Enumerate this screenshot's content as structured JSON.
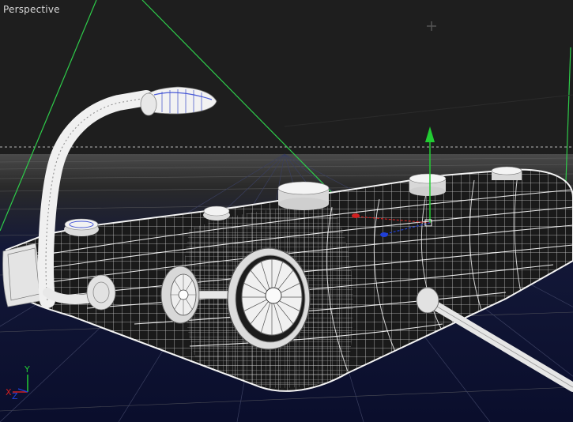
{
  "viewport": {
    "label": "Perspective",
    "mode": "wireframe-shaded"
  },
  "scene": {
    "object": "reel-handle-model",
    "icons": [
      "view-cube-marker-icon",
      "move-gizmo-icon",
      "axis-gizmo-icon"
    ]
  },
  "axis_gizmo": {
    "y_label": "Y",
    "x_label": "X",
    "z_label": "Z"
  },
  "colors": {
    "viewport_bg": "#1e1e1e",
    "floor_bg": "#0c1030",
    "wire": "#e6e6e6",
    "frustum_line": "#2ecc4a",
    "axis_y": "#22cc33",
    "axis_x": "#d02020",
    "axis_z": "#2040d8",
    "horizon_dash": "#b8b8b8"
  }
}
